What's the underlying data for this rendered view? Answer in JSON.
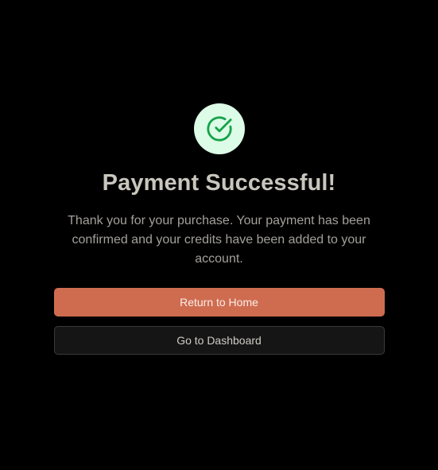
{
  "status": {
    "icon": "check-circle-icon",
    "icon_color": "#16a34a",
    "badge_color": "#dcfce7"
  },
  "title": "Payment Successful!",
  "message": "Thank you for your purchase. Your payment has been confirmed and your credits have been added to your account.",
  "actions": {
    "primary_label": "Return to Home",
    "primary_color": "#cf6c50",
    "secondary_label": "Go to Dashboard"
  }
}
